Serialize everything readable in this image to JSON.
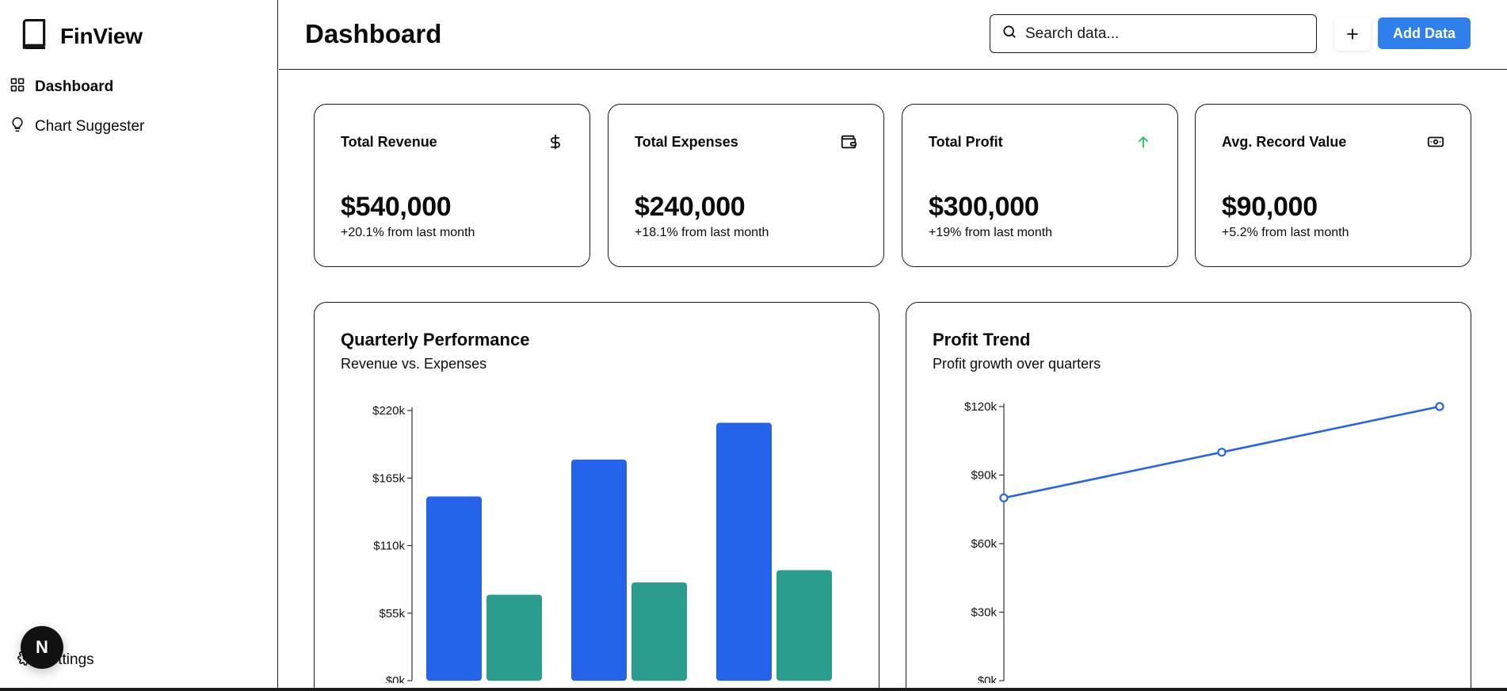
{
  "brand": {
    "name": "FinView",
    "icon": "book-icon"
  },
  "sidebar": {
    "items": [
      {
        "label": "Dashboard",
        "icon": "grid-icon",
        "active": true
      },
      {
        "label": "Chart Suggester",
        "icon": "lightbulb-icon",
        "active": false
      }
    ],
    "settings_label": "Settings",
    "badge_letter": "N"
  },
  "header": {
    "title": "Dashboard",
    "search_placeholder": "Search data...",
    "add_label": "Add Data"
  },
  "stats": [
    {
      "title": "Total Revenue",
      "value": "$540,000",
      "change": "+20.1% from last month",
      "icon": "dollar-icon"
    },
    {
      "title": "Total Expenses",
      "value": "$240,000",
      "change": "+18.1% from last month",
      "icon": "wallet-icon"
    },
    {
      "title": "Total Profit",
      "value": "$300,000",
      "change": "+19% from last month",
      "icon": "arrow-up-icon",
      "icon_color": "#22c55e"
    },
    {
      "title": "Avg. Record Value",
      "value": "$90,000",
      "change": "+5.2% from last month",
      "icon": "banknote-icon"
    }
  ],
  "charts": {
    "quarterly": {
      "title": "Quarterly Performance",
      "subtitle": "Revenue vs. Expenses"
    },
    "profit": {
      "title": "Profit Trend",
      "subtitle": "Profit growth over quarters"
    }
  },
  "chart_data": [
    {
      "type": "bar",
      "title": "Quarterly Performance",
      "subtitle": "Revenue vs. Expenses",
      "categories": [
        "",
        "",
        ""
      ],
      "series": [
        {
          "values": [
            150000,
            180000,
            210000
          ],
          "color": "#2563eb"
        },
        {
          "values": [
            70000,
            80000,
            90000
          ],
          "color": "#2a9d8f"
        }
      ],
      "ylim": [
        0,
        220000
      ],
      "yticks": [
        "$0k",
        "$55k",
        "$110k",
        "$165k",
        "$220k"
      ],
      "ytick_values": [
        0,
        55000,
        110000,
        165000,
        220000
      ],
      "grid": false
    },
    {
      "type": "line",
      "title": "Profit Trend",
      "subtitle": "Profit growth over quarters",
      "series": [
        {
          "values": [
            80000,
            100000,
            120000
          ],
          "color": "#2563eb"
        }
      ],
      "ylim": [
        0,
        120000
      ],
      "yticks": [
        "$0k",
        "$30k",
        "$60k",
        "$90k",
        "$120k"
      ],
      "ytick_values": [
        0,
        30000,
        60000,
        90000,
        120000
      ],
      "grid": false
    }
  ]
}
